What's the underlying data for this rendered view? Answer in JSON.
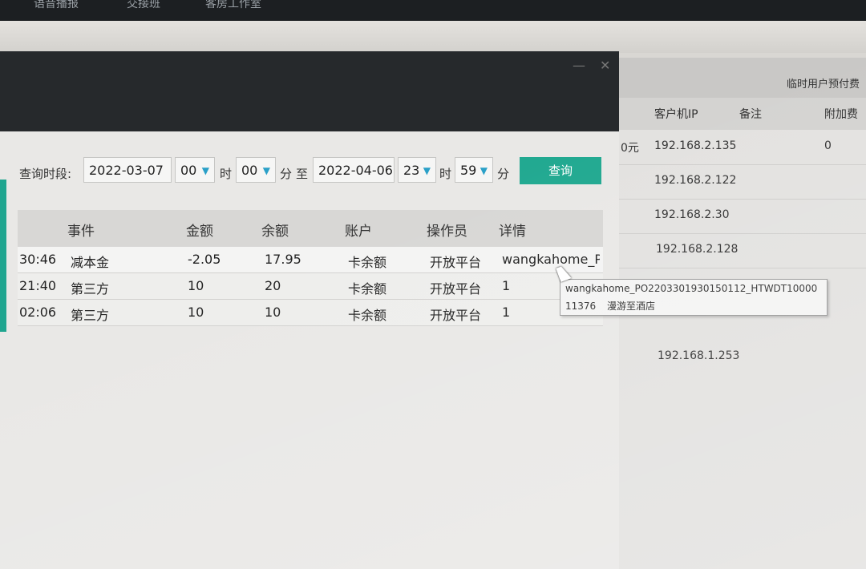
{
  "taskbar": {
    "items": [
      "语音播报",
      "交接班",
      "客房工作室"
    ]
  },
  "background_window": {
    "title": "临时用户预付费",
    "columns": [
      "客户机IP",
      "备注",
      "附加费"
    ],
    "rows": [
      {
        "prefix": "0元",
        "ip": "192.168.2.135",
        "extra": "0"
      },
      {
        "prefix": "",
        "ip": "192.168.2.122",
        "extra": ""
      },
      {
        "prefix": "",
        "ip": "192.168.2.30",
        "extra": ""
      },
      {
        "prefix": "",
        "ip": "192.168.2.128",
        "extra": ""
      },
      {
        "prefix": "",
        "ip": "192.168.1.253",
        "extra": ""
      }
    ]
  },
  "query": {
    "label": "查询时段:",
    "start_date": "2022-03-07",
    "start_hour": "00",
    "hour_unit": "时",
    "start_minute": "00",
    "minute_unit": "分",
    "to_label": "至",
    "end_date": "2022-04-06",
    "end_hour": "23",
    "end_minute": "59",
    "button": "查询"
  },
  "table": {
    "headers": [
      "事件",
      "金额",
      "余额",
      "账户",
      "操作员",
      "详情"
    ],
    "rows": [
      {
        "time": "30:46",
        "event": "减本金",
        "amount": "-2.05",
        "balance": "17.95",
        "account": "卡余额",
        "operator": "开放平台",
        "detail": "wangkahome_PO"
      },
      {
        "time": "21:40",
        "event": "第三方",
        "amount": "10",
        "balance": "20",
        "account": "卡余额",
        "operator": "开放平台",
        "detail": "1"
      },
      {
        "time": "02:06",
        "event": "第三方",
        "amount": "10",
        "balance": "10",
        "account": "卡余额",
        "operator": "开放平台",
        "detail": "1"
      }
    ]
  },
  "tooltip": {
    "line1": "wangkahome_PO2203301930150112_HTWDT10000",
    "line2_id": "11376",
    "line2_text": "漫游至酒店"
  }
}
